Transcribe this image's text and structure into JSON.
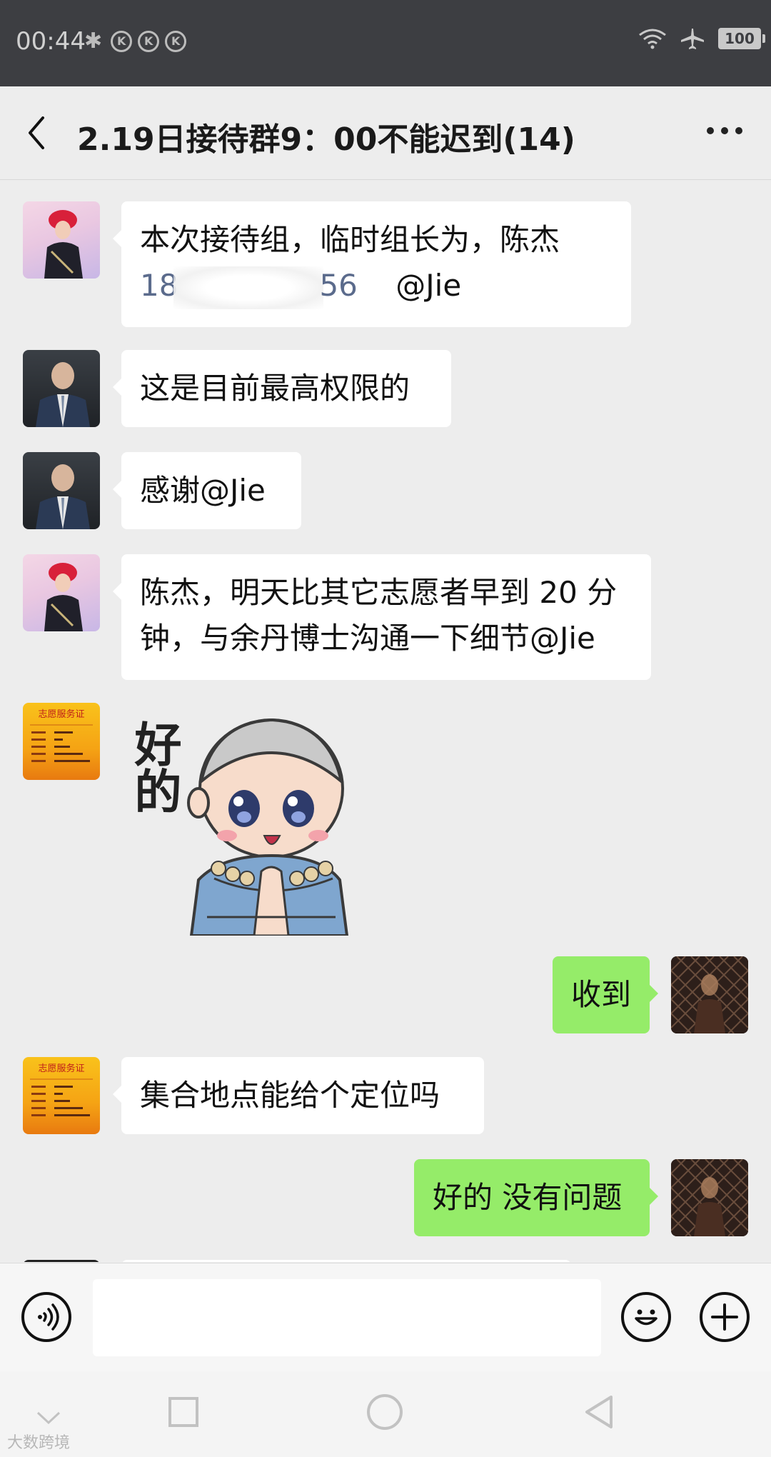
{
  "status_bar": {
    "time": "00:44",
    "battery": "100",
    "notif_glyph": "K"
  },
  "header": {
    "title": "2.19日接待群9：00不能迟到(14)"
  },
  "messages": [
    {
      "side": "left",
      "avatar": "girl",
      "line1": "本次接待组，临时组长为，陈杰",
      "phone_prefix": "18",
      "phone_suffix": "56",
      "mention": "@Jie"
    },
    {
      "side": "left",
      "avatar": "man",
      "text": "这是目前最高权限的"
    },
    {
      "side": "left",
      "avatar": "man",
      "text": "感谢@Jie"
    },
    {
      "side": "left",
      "avatar": "girl",
      "line1": "陈杰，明天比其它志愿者早到 20 分",
      "line2": "钟，与余丹博士沟通一下细节@Jie"
    },
    {
      "side": "left",
      "avatar": "volunteer-card",
      "sticker_text": "好的",
      "type": "sticker"
    },
    {
      "side": "right",
      "avatar": "me",
      "text": "收到"
    },
    {
      "side": "left",
      "avatar": "volunteer-card",
      "text": "集合地点能给个定位吗"
    },
    {
      "side": "right",
      "avatar": "me",
      "text": "好的 没有问题"
    }
  ],
  "card_avatar": {
    "title": "志愿服务证"
  },
  "watermark": "大数跨境",
  "colors": {
    "chat_bg": "#ededed",
    "bubble_mine": "#95ec69",
    "bubble_other": "#ffffff",
    "status_bar": "#3d3e42"
  }
}
